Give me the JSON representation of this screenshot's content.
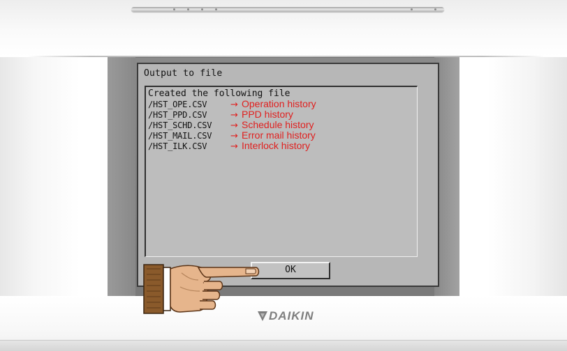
{
  "dialog": {
    "title": "Output to file",
    "message": "Created the following file",
    "files": [
      {
        "name": "/HST_OPE.CSV",
        "arrow": "→",
        "description": "Operation history"
      },
      {
        "name": "/HST_PPD.CSV",
        "arrow": "→",
        "description": "PPD history"
      },
      {
        "name": "/HST_SCHD.CSV",
        "arrow": "→",
        "description": "Schedule history"
      },
      {
        "name": "/HST_MAIL.CSV",
        "arrow": "→",
        "description": "Error mail history"
      },
      {
        "name": "/HST_ILK.CSV",
        "arrow": "→",
        "description": "Interlock history"
      }
    ],
    "ok_label": "OK"
  },
  "brand": {
    "logo_text": "DAIKIN",
    "logo_color": "#7e7e7e"
  },
  "colors": {
    "annotation_red": "#e0201f",
    "lcd_background": "#b7b7b7",
    "screen_frame": "#828282"
  },
  "icons": {
    "pointer": "pointing-hand-icon",
    "logo_mark": "daikin-logo-mark-icon"
  }
}
